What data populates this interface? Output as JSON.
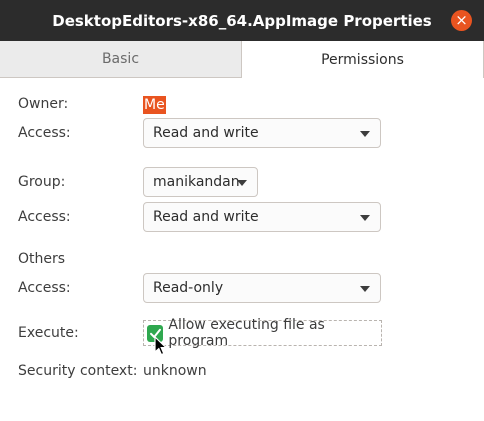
{
  "window": {
    "title": "DesktopEditors-x86_64.AppImage Properties",
    "close_symbol": "×"
  },
  "tabs": [
    {
      "label": "Basic",
      "active": false
    },
    {
      "label": "Permissions",
      "active": true
    }
  ],
  "permissions": {
    "owner": {
      "label": "Owner:",
      "value": "Me"
    },
    "owner_access": {
      "label": "Access:",
      "value": "Read and write"
    },
    "group": {
      "label": "Group:",
      "value": "manikandan"
    },
    "group_access": {
      "label": "Access:",
      "value": "Read and write"
    },
    "others": {
      "label": "Others"
    },
    "others_access": {
      "label": "Access:",
      "value": "Read-only"
    },
    "execute": {
      "label": "Execute:",
      "checkbox_label": "Allow executing file as program",
      "checked": true
    },
    "security_context": {
      "label": "Security context:",
      "value": "unknown"
    }
  },
  "colors": {
    "accent": "#e95420",
    "check": "#2fa84f",
    "titlebar": "#2c2c2c"
  }
}
